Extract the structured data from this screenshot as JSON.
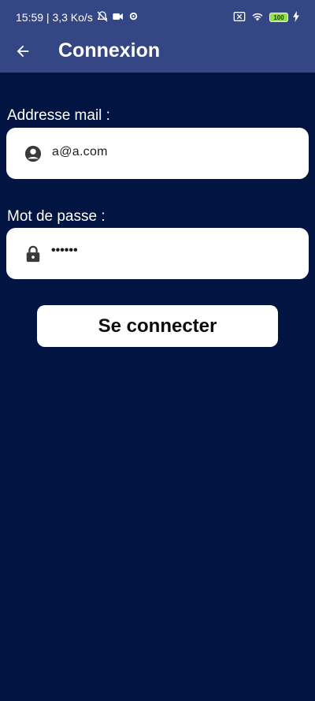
{
  "status_bar": {
    "time_speed": "15:59 | 3,3 Ko/s",
    "battery_level": "100",
    "icons": [
      "bell-off-icon",
      "video-icon",
      "gear-icon",
      "sim-off-icon",
      "wifi-icon",
      "battery-icon",
      "charging-icon"
    ]
  },
  "app_bar": {
    "title": "Connexion",
    "back_icon": "arrow-left-icon"
  },
  "email": {
    "label": "Addresse mail :",
    "value": "a@a.com",
    "icon": "account-circle-icon"
  },
  "password": {
    "label": "Mot de passe :",
    "masked_value": "••••••",
    "icon": "lock-icon"
  },
  "submit": {
    "label": "Se connecter"
  },
  "colors": {
    "background": "#011442",
    "app_bar": "#344784",
    "field": "#ffffff",
    "text": "#ffffff"
  }
}
